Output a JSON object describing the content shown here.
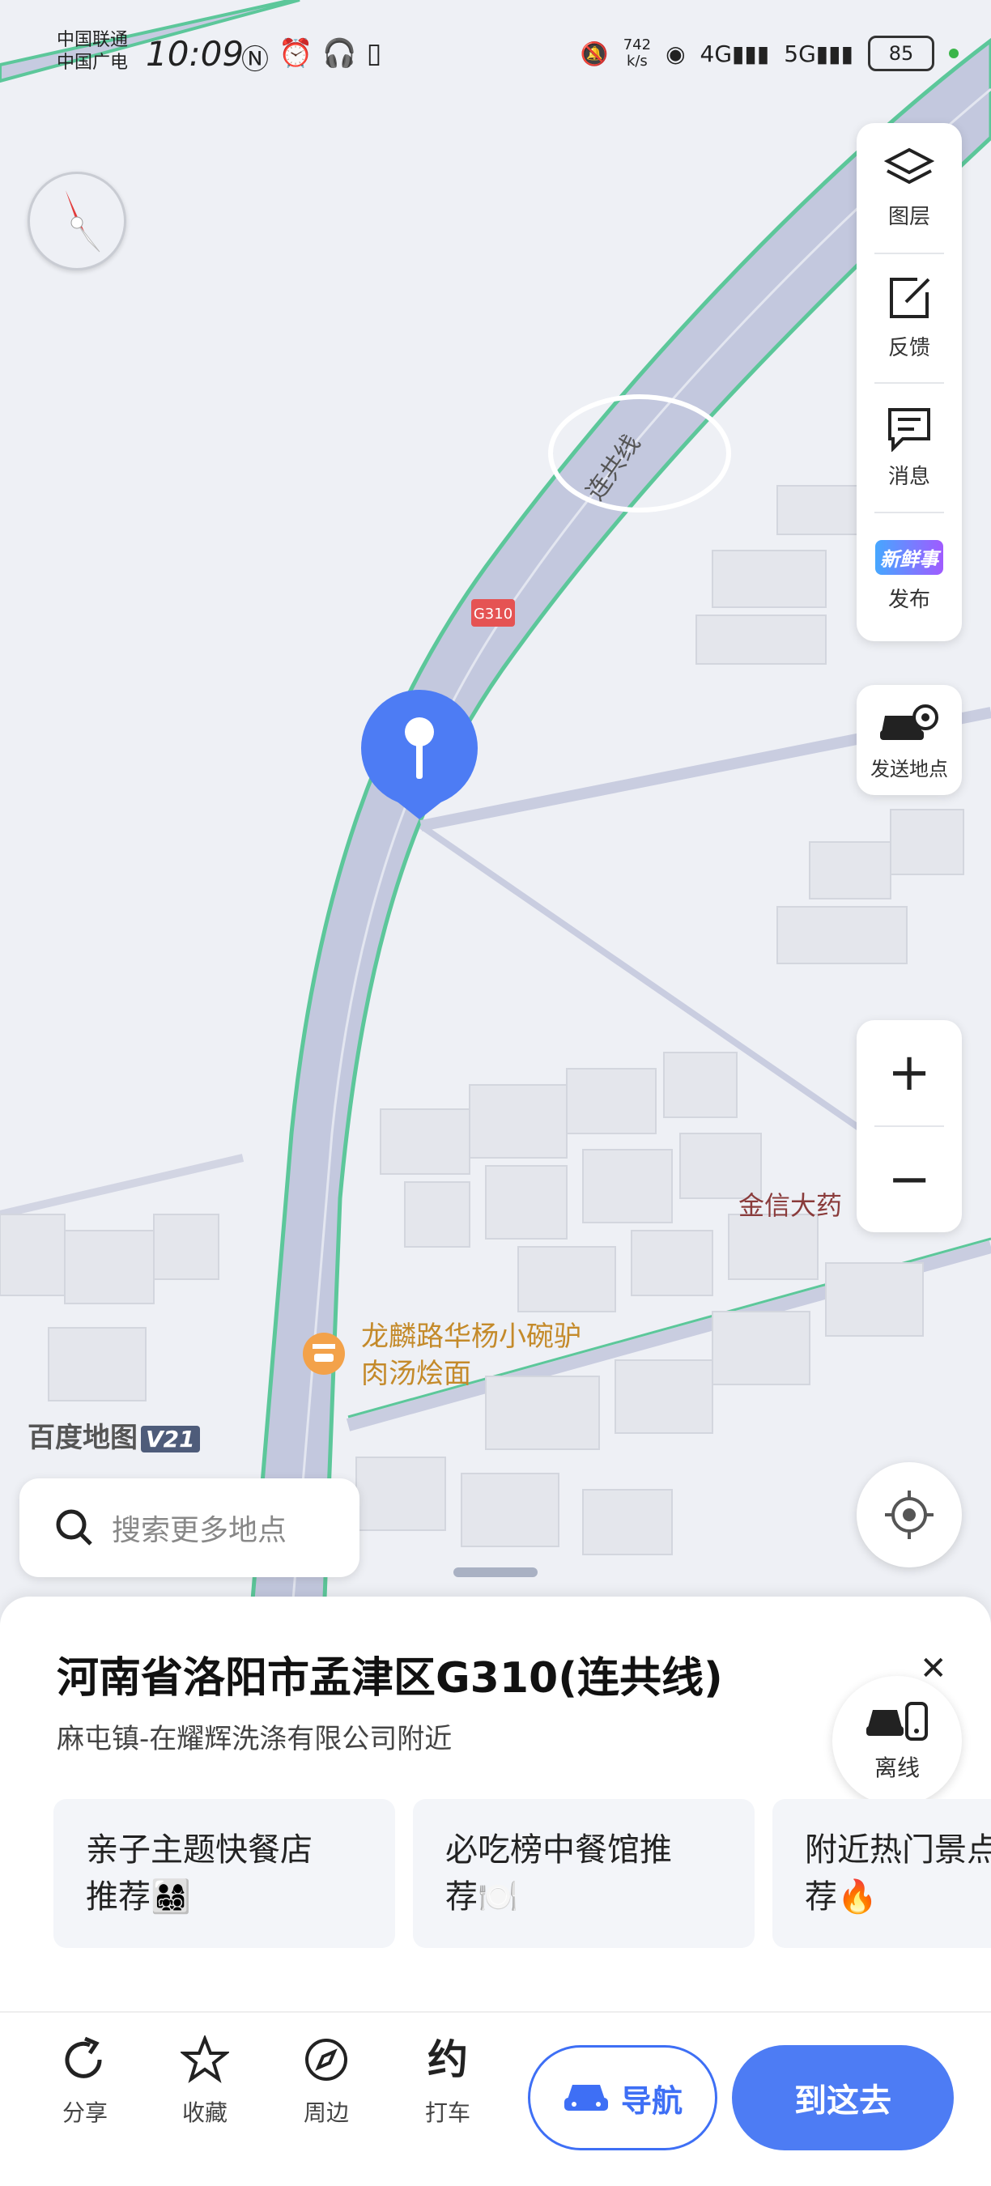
{
  "status_bar": {
    "carrier_1": "中国联通",
    "carrier_2": "中国广电",
    "time": "10:09",
    "speed_value": "742",
    "speed_unit": "k/s",
    "net_1": "4G",
    "net_2": "5G",
    "battery": "85"
  },
  "map": {
    "road_label": "连共线",
    "highway_shield": "G310",
    "poi_building": "金信大药",
    "poi_restaurant": "龙麟路华杨小碗驴肉汤烩面"
  },
  "tools": {
    "layers": "图层",
    "feedback": "反馈",
    "messages": "消息",
    "publish_badge": "新鲜事",
    "publish": "发布",
    "send_location": "发送地点"
  },
  "logo": {
    "name": "百度地图",
    "version": "V21"
  },
  "search": {
    "placeholder": "搜索更多地点"
  },
  "place": {
    "title": "河南省洛阳市孟津区G310(连共线)",
    "subtitle": "麻屯镇-在耀辉洗涤有限公司附近",
    "offline_label": "离线",
    "cards": [
      {
        "line1": "亲子主题快餐店",
        "line2": "推荐👨‍👩‍👧‍👦"
      },
      {
        "line1": "必吃榜中餐馆推",
        "line2": "荐🍽️"
      },
      {
        "line1": "附近热门景点",
        "line2": "荐🔥"
      }
    ]
  },
  "bottom_bar": {
    "share": "分享",
    "favorite": "收藏",
    "nearby": "周边",
    "taxi": "打车",
    "navigate": "导航",
    "go": "到这去"
  },
  "colors": {
    "accent": "#4d7cf4",
    "road_edge": "#5cc79a",
    "pin": "#3e6ff5"
  }
}
